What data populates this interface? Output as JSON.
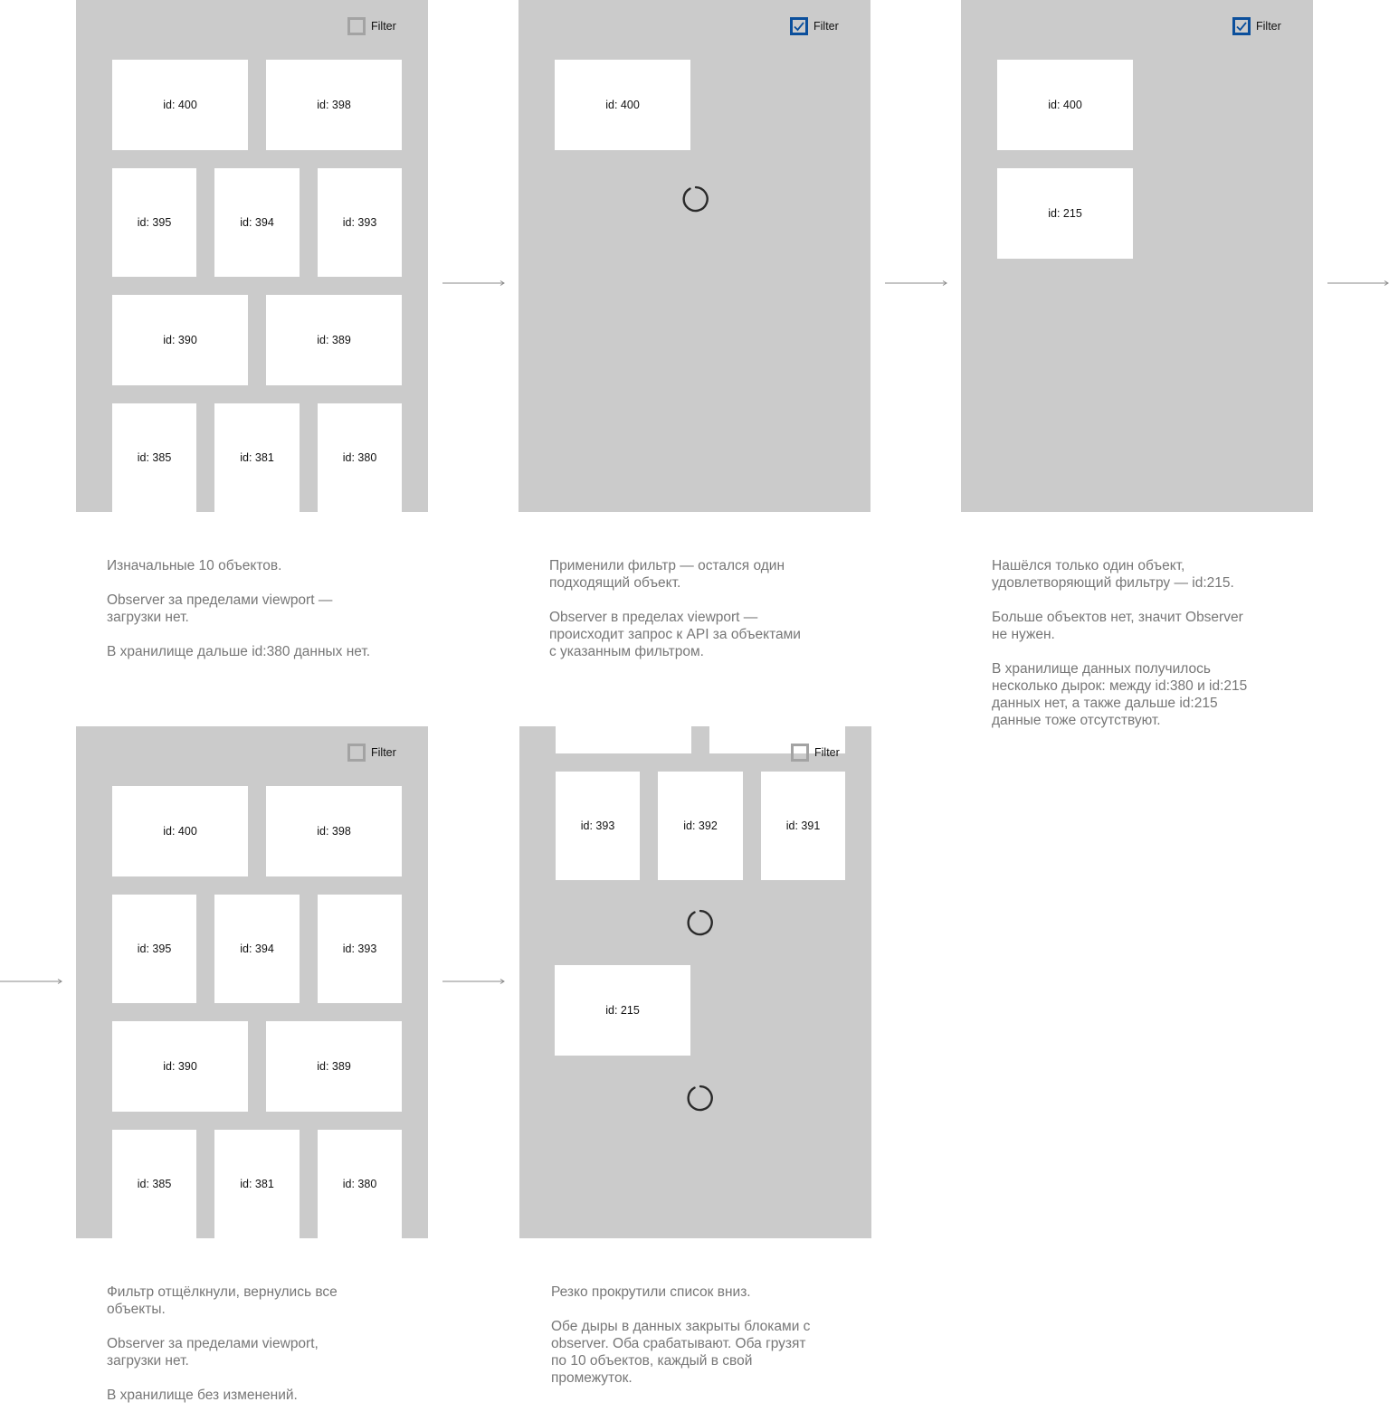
{
  "frames": [
    {
      "filter_label": "Filter",
      "filter_checked": false,
      "tiles": [
        "id: 400",
        "id: 398",
        "id: 395",
        "id: 394",
        "id: 393",
        "id: 390",
        "id: 389",
        "id: 385",
        "id: 381",
        "id: 380"
      ],
      "description": [
        "Изначальные 10 объектов.",
        "Observer за пределами viewport —\nзагрузки нет.",
        "В хранилище дальше id:380 данных нет."
      ]
    },
    {
      "filter_label": "Filter",
      "filter_checked": true,
      "tiles": [
        "id: 400"
      ],
      "description": [
        "Применили фильтр — остался один\nподходящий объект.",
        "Observer в пределах viewport —\nпроисходит запрос к API за объектами\nс указанным фильтром."
      ]
    },
    {
      "filter_label": "Filter",
      "filter_checked": true,
      "tiles": [
        "id: 400",
        "id: 215"
      ],
      "description": [
        "Нашёлся только один объект,\nудовлетворяющий фильтру — id:215.",
        "Больше объектов нет, значит Observer\nне нужен.",
        "В хранилище данных получилось\nнесколько дырок: между id:380 и id:215\nданных нет, а также дальше id:215\nданные тоже отсутствуют."
      ]
    },
    {
      "filter_label": "Filter",
      "filter_checked": false,
      "tiles": [
        "id: 400",
        "id: 398",
        "id: 395",
        "id: 394",
        "id: 393",
        "id: 390",
        "id: 389",
        "id: 385",
        "id: 381",
        "id: 380"
      ],
      "description": [
        "Фильтр отщёлкнули, вернулись все\nобъекты.",
        "Observer за пределами viewport,\nзагрузки нет.",
        "В хранилище без изменений."
      ]
    },
    {
      "filter_label": "Filter",
      "filter_checked": false,
      "tiles": [
        "",
        "",
        "id: 393",
        "id: 392",
        "id: 391",
        "id: 215"
      ],
      "description": [
        "Резко прокрутили список вниз.",
        "Обе дыры в данных закрыты блоками с\nobserver. Оба срабатывают. Оба грузят\nпо 10 объектов, каждый в свой\nпромежуток."
      ]
    }
  ],
  "colors": {
    "frame_bg": "#cbcbcb",
    "tile_bg": "#ffffff",
    "checkbox_checked": "#0b4f9c",
    "checkbox_unchecked": "#a3a3a3",
    "description_text": "#777777"
  },
  "icons": {
    "spinner": "loading-spinner-icon",
    "arrow": "right-arrow-icon",
    "check": "checkmark-icon"
  }
}
